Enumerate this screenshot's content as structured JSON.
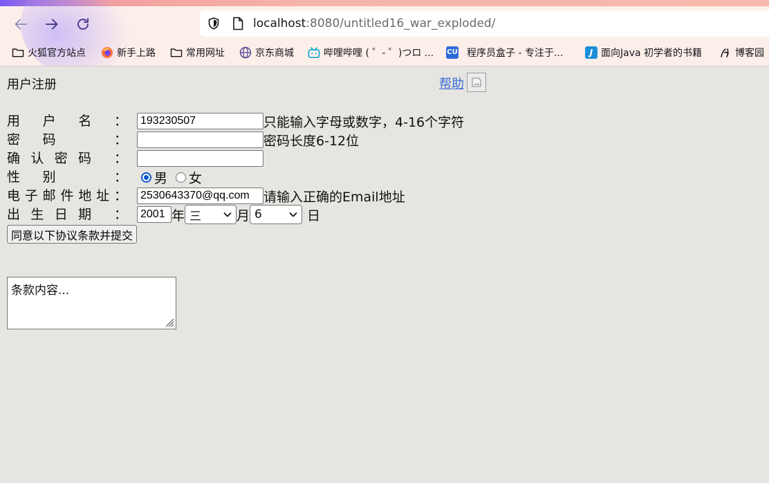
{
  "browser": {
    "url_host": "localhost",
    "url_rest": ":8080/untitled16_war_exploded/",
    "bookmarks": [
      {
        "label": "火狐官方站点",
        "icon": "folder-icon"
      },
      {
        "label": "新手上路",
        "icon": "firefox-icon"
      },
      {
        "label": "常用网址",
        "icon": "folder-icon"
      },
      {
        "label": "京东商城",
        "icon": "globe-icon"
      },
      {
        "label": "哔哩哔哩 ( ゜- ゜)つロ ...",
        "icon": "bilibili-icon"
      },
      {
        "label": "程序员盒子 - 专注于...",
        "icon": "cu-icon",
        "icon_text": "CU"
      },
      {
        "label": "面向Java 初学者的书籍",
        "icon": "java-icon",
        "icon_text": "J"
      },
      {
        "label": "博客园",
        "icon": "cnblogs-icon"
      }
    ]
  },
  "page": {
    "title": "用户注册",
    "help_link": "帮助"
  },
  "form": {
    "username": {
      "label_chars": [
        "用",
        "户",
        "名"
      ],
      "value": "193230507",
      "hint": "只能输入字母或数字，4-16个字符"
    },
    "password": {
      "label_chars": [
        "密",
        "码"
      ],
      "value": "",
      "hint": "密码长度6-12位"
    },
    "confirm": {
      "label_chars": [
        "确",
        "认",
        "密",
        "码"
      ],
      "value": ""
    },
    "gender": {
      "label_chars": [
        "性",
        "别"
      ],
      "options": [
        "男",
        "女"
      ],
      "selected": "男"
    },
    "email": {
      "label_chars": [
        "电",
        "子",
        "邮",
        "件",
        "地",
        "址"
      ],
      "value": "2530643370@qq.com",
      "hint": "请输入正确的Email地址"
    },
    "birthday": {
      "label_chars": [
        "出",
        "生",
        "日",
        "期"
      ],
      "year": "2001",
      "year_unit": "年",
      "month": "三",
      "month_unit": "月",
      "day": "6",
      "day_unit": "日"
    },
    "colon": "：",
    "submit_label": "同意以下协议条款并提交",
    "terms_text": "条款内容..."
  }
}
